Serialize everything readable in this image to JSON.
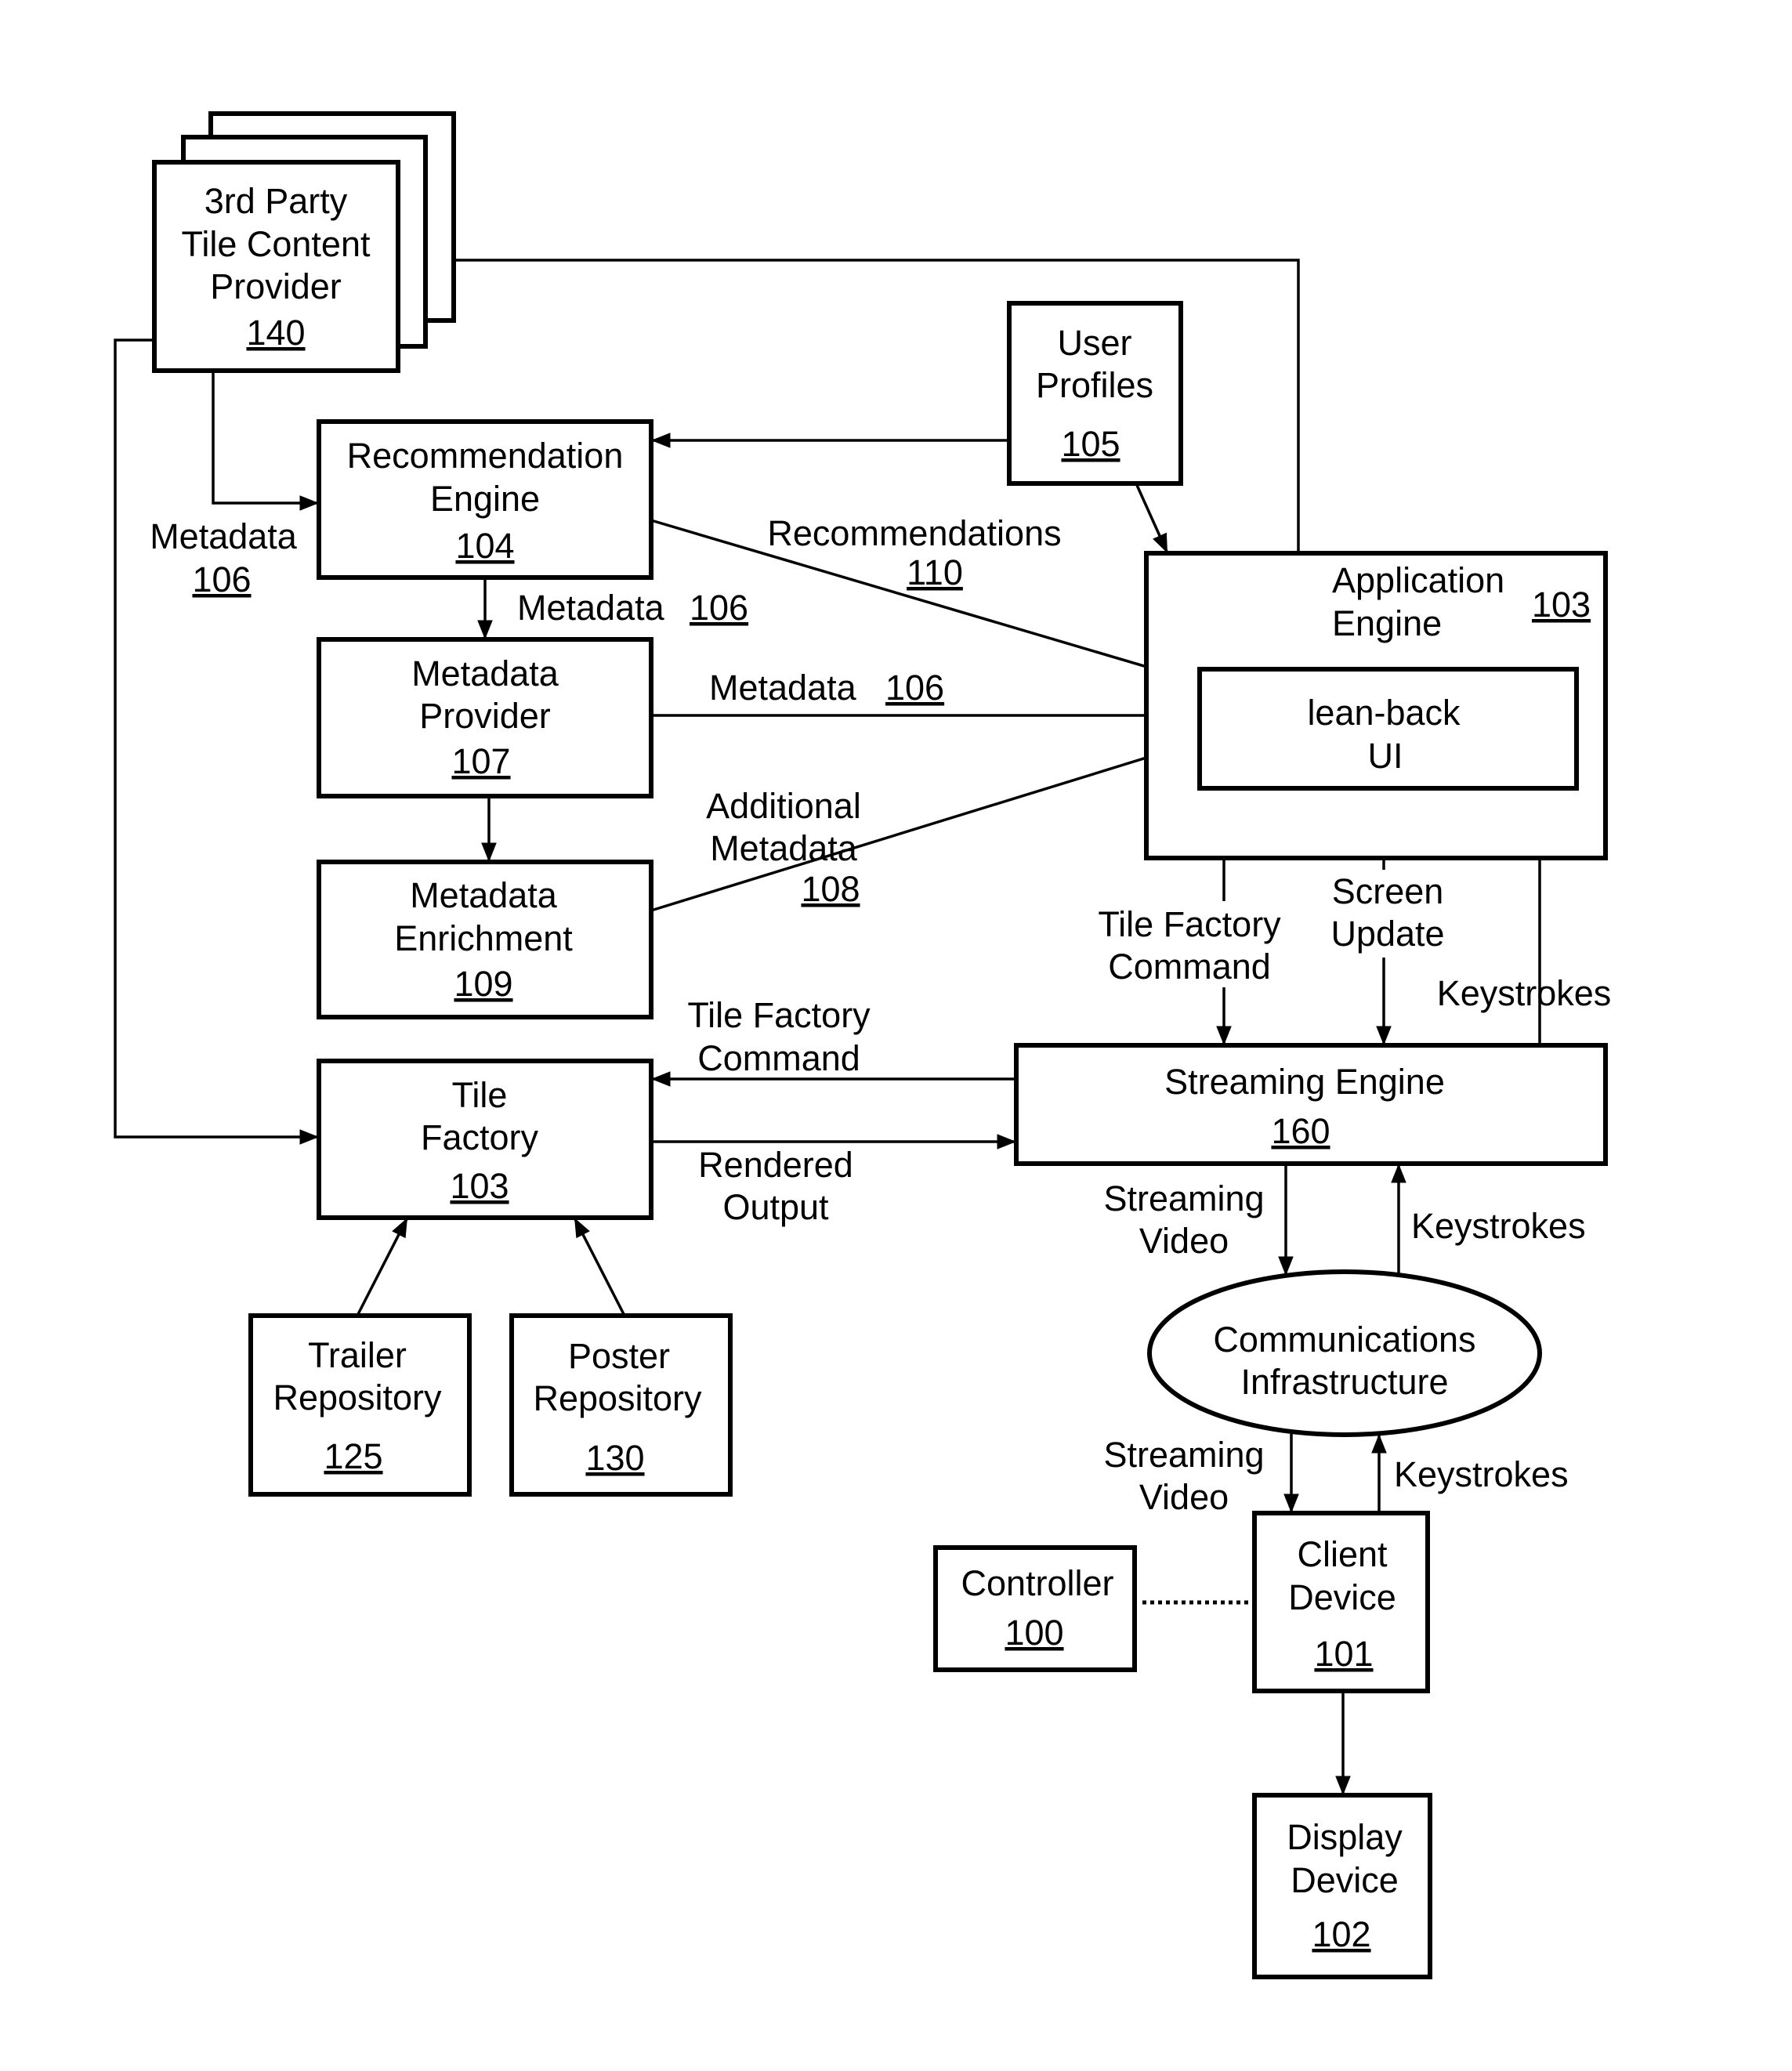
{
  "diagram": {
    "nodes": {
      "third_party": {
        "lines": [
          "3rd Party",
          "Tile Content",
          "Provider"
        ],
        "ref": "140"
      },
      "recommendation_engine": {
        "lines": [
          "Recommendation",
          "Engine"
        ],
        "ref": "104"
      },
      "metadata_provider": {
        "lines": [
          "Metadata",
          "Provider"
        ],
        "ref": "107"
      },
      "metadata_enrichment": {
        "lines": [
          "Metadata",
          "Enrichment"
        ],
        "ref": "109"
      },
      "tile_factory": {
        "lines": [
          "Tile",
          "Factory"
        ],
        "ref": "103"
      },
      "trailer_repository": {
        "lines": [
          "Trailer",
          "Repository"
        ],
        "ref": "125"
      },
      "poster_repository": {
        "lines": [
          "Poster",
          "Repository"
        ],
        "ref": "130"
      },
      "user_profiles": {
        "lines": [
          "User",
          "Profiles"
        ],
        "ref": "105"
      },
      "application_engine": {
        "lines": [
          "Application",
          "Engine"
        ],
        "ref": "103"
      },
      "lean_back_ui": {
        "lines": [
          "lean-back",
          "UI"
        ]
      },
      "streaming_engine": {
        "lines": [
          "Streaming Engine"
        ],
        "ref": "160"
      },
      "communications": {
        "lines": [
          "Communications",
          "Infrastructure"
        ]
      },
      "controller": {
        "lines": [
          "Controller"
        ],
        "ref": "100"
      },
      "client_device": {
        "lines": [
          "Client",
          "Device"
        ],
        "ref": "101"
      },
      "display_device": {
        "lines": [
          "Display",
          "Device"
        ],
        "ref": "102"
      }
    },
    "edge_labels": {
      "metadata_left": {
        "text": "Metadata",
        "ref": "106"
      },
      "metadata_rec_to_provider": {
        "text": "Metadata",
        "ref": "106"
      },
      "recommendations": {
        "text": "Recommendations",
        "ref": "110"
      },
      "metadata_provider_to_ui": {
        "text": "Metadata",
        "ref": "106"
      },
      "additional_metadata": {
        "lines": [
          "Additional",
          "Metadata"
        ],
        "ref": "108"
      },
      "tile_factory_command_ui": {
        "lines": [
          "Tile Factory",
          "Command"
        ]
      },
      "screen_update": {
        "lines": [
          "Screen",
          "Update"
        ]
      },
      "keystrokes_ui": {
        "text": "Keystrokes"
      },
      "tile_factory_command_left": {
        "lines": [
          "Tile Factory",
          "Command"
        ]
      },
      "rendered_output": {
        "lines": [
          "Rendered",
          "Output"
        ]
      },
      "streaming_video_top": {
        "lines": [
          "Streaming",
          "Video"
        ]
      },
      "keystrokes_top": {
        "text": "Keystrokes"
      },
      "streaming_video_bottom": {
        "lines": [
          "Streaming",
          "Video"
        ]
      },
      "keystrokes_bottom": {
        "text": "Keystrokes"
      }
    }
  }
}
